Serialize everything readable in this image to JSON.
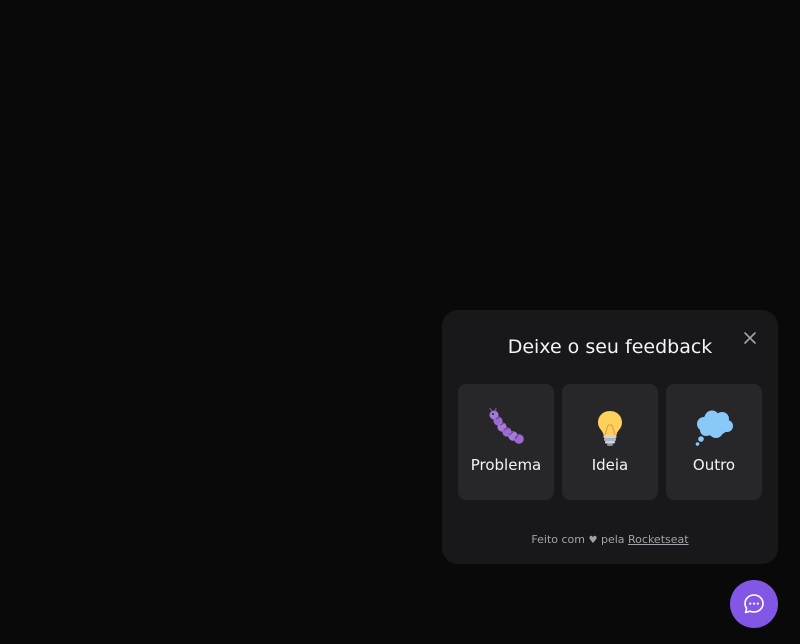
{
  "widget": {
    "title": "Deixe o seu feedback",
    "close_icon": "close-icon",
    "types": [
      {
        "label": "Problema",
        "icon": "bug-icon"
      },
      {
        "label": "Ideia",
        "icon": "lightbulb-icon"
      },
      {
        "label": "Outro",
        "icon": "thought-bubble-icon"
      }
    ],
    "footer": {
      "prefix": "Feito com",
      "heart": "♥",
      "middle": "pela",
      "link": "Rocketseat"
    }
  },
  "fab": {
    "icon": "chat-bubble-icon"
  },
  "colors": {
    "background": "#09090a",
    "panel": "#18181b",
    "card": "#27272a",
    "accent": "#8257e5",
    "text": "#f4f4f5",
    "muted": "#a1a1aa"
  }
}
